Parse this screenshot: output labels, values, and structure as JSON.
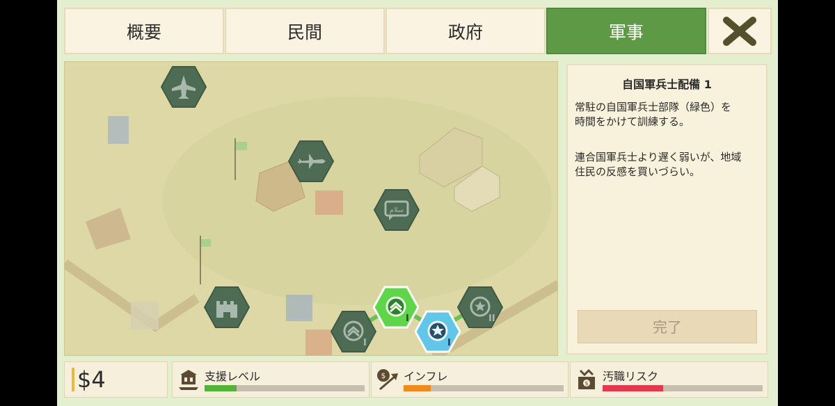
{
  "tabs": [
    {
      "label": "概要",
      "active": false
    },
    {
      "label": "民間",
      "active": false
    },
    {
      "label": "政府",
      "active": false
    },
    {
      "label": "軍事",
      "active": true
    }
  ],
  "close_icon": "close-x-icon",
  "tech_tree": {
    "nodes": [
      {
        "name": "jet-fighter-icon",
        "state": "locked"
      },
      {
        "name": "drone-icon",
        "state": "locked"
      },
      {
        "name": "arabic-speech-icon",
        "state": "locked"
      },
      {
        "name": "fortress-icon",
        "state": "locked"
      },
      {
        "name": "soldier-rank-icon",
        "state": "locked",
        "level": "I"
      },
      {
        "name": "soldier-rank-icon",
        "state": "completed",
        "level": "I"
      },
      {
        "name": "soldier-star-icon",
        "state": "selected",
        "level": "I"
      },
      {
        "name": "soldier-star-icon",
        "state": "locked",
        "level": "II"
      }
    ]
  },
  "info_panel": {
    "title": "自国軍兵士配備 1",
    "desc1_line1": "常駐の自国軍兵士部隊（緑色）を",
    "desc1_line2": "時間をかけて訓練する。",
    "desc2_line1": "連合国軍兵士より遅く弱いが、地域",
    "desc2_line2": "住民の反感を買いづらい。",
    "button_label": "完了"
  },
  "bottom_bar": {
    "money": "$4",
    "stats": [
      {
        "label": "支援レベル",
        "icon": "support-building-icon",
        "fill": 0.2,
        "color": "#55b13a"
      },
      {
        "label": "インフレ",
        "icon": "inflation-coin-arrow-icon",
        "fill": 0.17,
        "color": "#f08a1c"
      },
      {
        "label": "汚職リスク",
        "icon": "corruption-moneybag-icon",
        "fill": 0.38,
        "color": "#e4384d"
      }
    ]
  },
  "colors": {
    "active_tab": "#5e9a45",
    "locked_hex": "#4e6b53",
    "completed_hex": "#5fd64a",
    "selected_hex": "#62c6e8"
  }
}
